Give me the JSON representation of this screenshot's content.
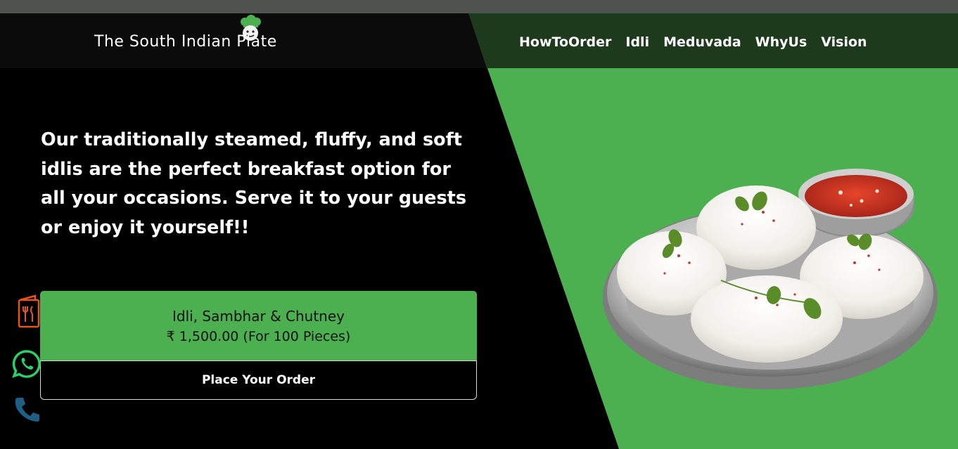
{
  "brand": {
    "logo_text": "The South Indian Plate"
  },
  "nav": {
    "items": [
      {
        "label": "HowToOrder"
      },
      {
        "label": "Idli"
      },
      {
        "label": "Meduvada"
      },
      {
        "label": "WhyUs"
      },
      {
        "label": "Vision"
      }
    ]
  },
  "hero": {
    "description": "Our traditionally steamed, fluffy, and soft idlis are the perfect breakfast option for all your occasions. Serve it to your guests or enjoy it yourself!!"
  },
  "product": {
    "name": "Idli, Sambhar & Chutney",
    "price": "₹ 1,500.00 (For 100 Pieces)",
    "order_button": "Place Your Order"
  },
  "floating_icons": [
    "menu-icon",
    "whatsapp-icon",
    "phone-icon"
  ],
  "colors": {
    "accent_green": "#4caf50",
    "nav_dark_green": "#1d3a1d",
    "menu_icon": "#e8541e",
    "whatsapp": "#25d366",
    "phone": "#1f5f86"
  }
}
